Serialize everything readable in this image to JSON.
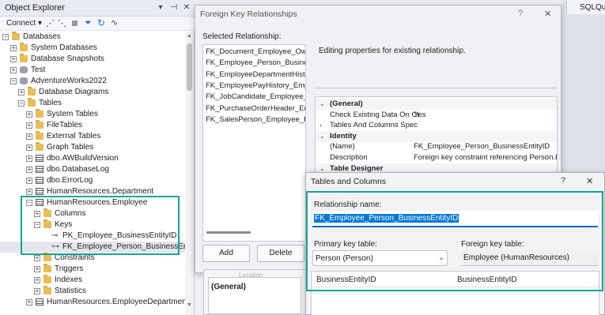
{
  "object_explorer": {
    "title": "Object Explorer",
    "connect_label": "Connect",
    "tree": [
      {
        "label": "Databases",
        "level": 0,
        "expander": "-",
        "icon": "folder"
      },
      {
        "label": "System Databases",
        "level": 1,
        "expander": "+",
        "icon": "folder"
      },
      {
        "label": "Database Snapshots",
        "level": 1,
        "expander": "+",
        "icon": "folder"
      },
      {
        "label": "Test",
        "level": 1,
        "expander": "+",
        "icon": "db"
      },
      {
        "label": "AdventureWorks2022",
        "level": 1,
        "expander": "-",
        "icon": "db"
      },
      {
        "label": "Database Diagrams",
        "level": 2,
        "expander": "+",
        "icon": "folder"
      },
      {
        "label": "Tables",
        "level": 2,
        "expander": "-",
        "icon": "folder"
      },
      {
        "label": "System Tables",
        "level": 3,
        "expander": "+",
        "icon": "folder"
      },
      {
        "label": "FileTables",
        "level": 3,
        "expander": "+",
        "icon": "folder"
      },
      {
        "label": "External Tables",
        "level": 3,
        "expander": "+",
        "icon": "folder"
      },
      {
        "label": "Graph Tables",
        "level": 3,
        "expander": "+",
        "icon": "folder"
      },
      {
        "label": "dbo.AWBuildVersion",
        "level": 3,
        "expander": "+",
        "icon": "table"
      },
      {
        "label": "dbo.DatabaseLog",
        "level": 3,
        "expander": "+",
        "icon": "table"
      },
      {
        "label": "dbo.ErrorLog",
        "level": 3,
        "expander": "+",
        "icon": "table"
      },
      {
        "label": "HumanResources.Department",
        "level": 3,
        "expander": "+",
        "icon": "table"
      },
      {
        "label": "HumanResources.Employee",
        "level": 3,
        "expander": "-",
        "icon": "table"
      },
      {
        "label": "Columns",
        "level": 4,
        "expander": "+",
        "icon": "folder"
      },
      {
        "label": "Keys",
        "level": 4,
        "expander": "-",
        "icon": "folder"
      },
      {
        "label": "PK_Employee_BusinessEntityID",
        "level": 5,
        "expander": "",
        "icon": "pk"
      },
      {
        "label": "FK_Employee_Person_BusinessEntityID",
        "level": 5,
        "expander": "",
        "icon": "fk"
      },
      {
        "label": "Constraints",
        "level": 4,
        "expander": "+",
        "icon": "folder"
      },
      {
        "label": "Triggers",
        "level": 4,
        "expander": "+",
        "icon": "folder"
      },
      {
        "label": "Indexes",
        "level": 4,
        "expander": "+",
        "icon": "folder"
      },
      {
        "label": "Statistics",
        "level": 4,
        "expander": "+",
        "icon": "folder"
      },
      {
        "label": "HumanResources.EmployeeDepartmentHistory",
        "level": 3,
        "expander": "+",
        "icon": "table"
      }
    ]
  },
  "sql_tab": {
    "label": "SQLQue"
  },
  "fk_dialog": {
    "title": "Foreign Key Relationships",
    "help": "?",
    "close": "✕",
    "selected_label": "Selected Relationship:",
    "relationships": [
      "FK_Document_Employee_Owner",
      "FK_Employee_Person_BusinessEntityID",
      "FK_EmployeeDepartmentHistory_Employee",
      "FK_EmployeePayHistory_Employee",
      "FK_JobCandidate_Employee_BusinessEntityID",
      "FK_PurchaseOrderHeader_Employee",
      "FK_SalesPerson_Employee_BusinessEntityID"
    ],
    "editing_text": "Editing properties for existing relationship.",
    "properties": [
      {
        "name": "(General)",
        "value": "",
        "kind": "category"
      },
      {
        "name": "Check Existing Data On Cr",
        "value": "Yes",
        "kind": "prop"
      },
      {
        "name": "Tables And Columns Spec",
        "value": "",
        "kind": "collapsed"
      },
      {
        "name": "Identity",
        "value": "",
        "kind": "category"
      },
      {
        "name": "(Name)",
        "value": "FK_Employee_Person_BusinessEntityID",
        "kind": "prop"
      },
      {
        "name": "Description",
        "value": "Foreign key constraint referencing Person.Busi",
        "kind": "prop"
      },
      {
        "name": "Table Designer",
        "value": "",
        "kind": "category"
      }
    ],
    "add_label": "Add",
    "delete_label": "Delete",
    "general_label": "(General)",
    "location_label": "Location"
  },
  "tc_dialog": {
    "title": "Tables and Columns",
    "help": "?",
    "close": "✕",
    "relationship_name_label": "Relationship name:",
    "relationship_name_value": "FK_Employee_Person_BusinessEntityID",
    "pk_table_label": "Primary key table:",
    "pk_table_value": "Person (Person)",
    "fk_table_label": "Foreign key table:",
    "fk_table_value": "Employee (HumanResources)",
    "pk_column": "BusinessEntityID",
    "fk_column": "BusinessEntityID"
  },
  "colors": {
    "highlight": "#14a58f",
    "selection": "#0078d7"
  }
}
